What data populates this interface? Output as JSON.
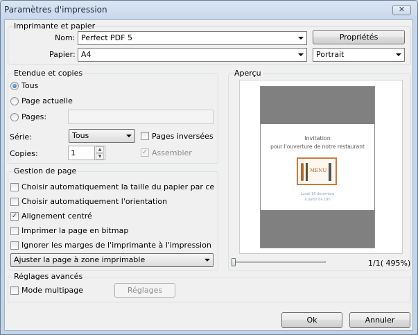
{
  "window": {
    "title": "Paramètres d'impression",
    "close_glyph": "✕"
  },
  "printer_group": {
    "legend": "Imprimante et papier",
    "name_label": "Nom:",
    "name_value": "Perfect PDF 5",
    "properties_button": "Propriétés",
    "paper_label": "Papier:",
    "paper_value": "A4",
    "orientation_value": "Portrait"
  },
  "range_group": {
    "legend": "Etendue et copies",
    "all_label": "Tous",
    "current_page_label": "Page actuelle",
    "pages_label": "Pages:",
    "pages_value": "",
    "series_label": "Série:",
    "series_value": "Tous",
    "reverse_label": "Pages inversées",
    "copies_label": "Copies:",
    "copies_value": "1",
    "collate_label": "Assembler"
  },
  "page_group": {
    "legend": "Gestion de page",
    "auto_paper_label": "Choisir automatiquement la taille du papier par celle de la pa",
    "auto_orientation_label": "Choisir automatiquement l'orientation",
    "center_label": "Alignement centré",
    "bitmap_label": "Imprimer la page en bitmap",
    "ignore_margins_label": "Ignorer les marges de l'imprimante à l'impression",
    "fit_value": "Ajuster la page à zone imprimable"
  },
  "preview_group": {
    "legend": "Aperçu",
    "doc_title_line1": "Invitation",
    "doc_title_line2": "pour l'ouverture de notre restaurant",
    "menu_word": "MENU",
    "doc_footer_line1": "Lundi 18 décembre",
    "doc_footer_line2": "à partir de 19h",
    "page_indicator": "1/1( 495%)",
    "zoom_fraction": 0.0
  },
  "advanced_group": {
    "legend": "Réglages avancés",
    "multipage_label": "Mode multipage",
    "settings_button": "Réglages"
  },
  "footer": {
    "ok_button": "Ok",
    "cancel_button": "Annuler"
  },
  "colors": {
    "accent_radio": "#1c5fb0",
    "menu_border": "#c87a3a",
    "menu_text": "#b5652a"
  }
}
